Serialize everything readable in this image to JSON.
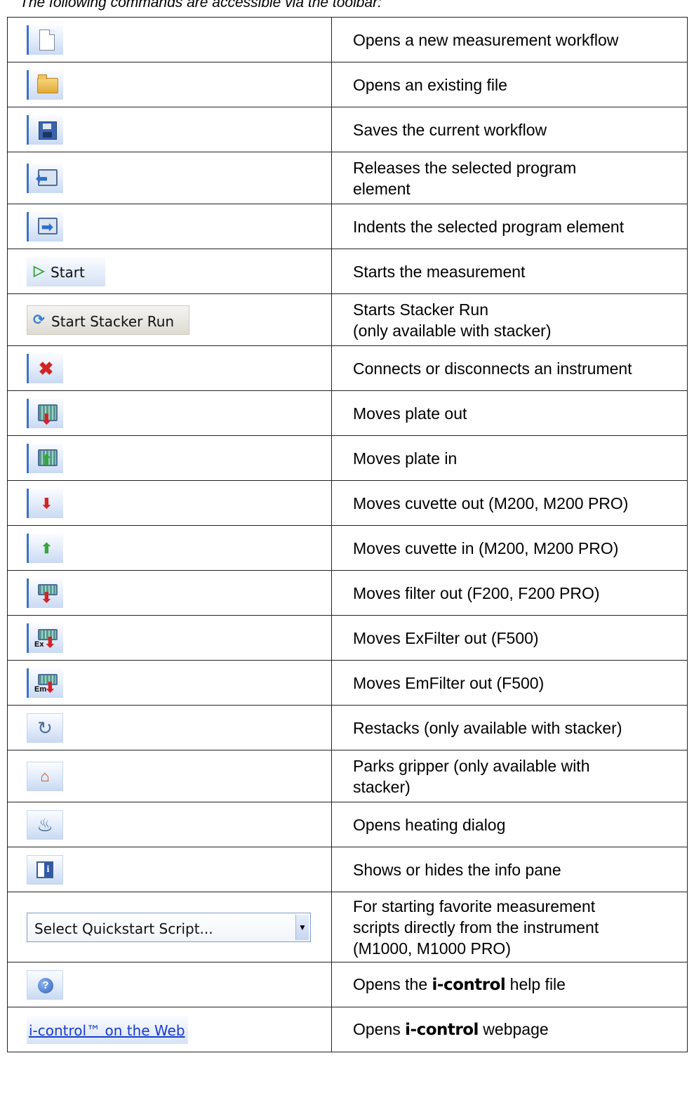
{
  "intro": "The following commands are accessible via the toolbar:",
  "rows": [
    {
      "icon": "new-file-icon",
      "desc": [
        "Opens a new measurement workflow"
      ]
    },
    {
      "icon": "open-folder-icon",
      "desc": [
        "Opens an existing file"
      ]
    },
    {
      "icon": "save-disk-icon",
      "desc": [
        "Saves the current workflow"
      ]
    },
    {
      "icon": "outdent-icon",
      "desc": [
        "Releases the selected program",
        "element"
      ]
    },
    {
      "icon": "indent-icon",
      "desc": [
        "Indents the selected program element"
      ]
    },
    {
      "icon": "start-icon",
      "button_label": "Start",
      "desc": [
        "Starts the measurement"
      ]
    },
    {
      "icon": "stacker-run-icon",
      "button_label": "Start Stacker Run",
      "desc": [
        "Starts Stacker Run",
        "(only available with stacker)"
      ]
    },
    {
      "icon": "connect-icon",
      "desc": [
        "Connects or disconnects an instrument"
      ]
    },
    {
      "icon": "plate-out-icon",
      "desc": [
        "Moves plate out"
      ]
    },
    {
      "icon": "plate-in-icon",
      "desc": [
        "Moves plate in"
      ]
    },
    {
      "icon": "cuvette-out-icon",
      "desc": [
        "Moves cuvette out (M200, M200 PRO)"
      ]
    },
    {
      "icon": "cuvette-in-icon",
      "desc": [
        "Moves cuvette in (M200, M200 PRO)"
      ]
    },
    {
      "icon": "filter-out-icon",
      "desc": [
        "Moves filter out (F200, F200 PRO)"
      ]
    },
    {
      "icon": "exfilter-out-icon",
      "icon_text": "Ex",
      "desc": [
        "Moves ExFilter out (F500)"
      ]
    },
    {
      "icon": "emfilter-out-icon",
      "icon_text": "Em",
      "desc": [
        "Moves EmFilter out (F500)"
      ]
    },
    {
      "icon": "restack-icon",
      "desc": [
        "Restacks (only available with stacker)"
      ]
    },
    {
      "icon": "park-gripper-icon",
      "desc": [
        "Parks gripper (only available with",
        "stacker)"
      ]
    },
    {
      "icon": "heating-icon",
      "desc": [
        "Opens heating dialog"
      ]
    },
    {
      "icon": "info-pane-icon",
      "desc": [
        "Shows or hides the info pane"
      ]
    },
    {
      "icon": "quickstart-dropdown",
      "combo_value": "Select Quickstart Script...",
      "desc": [
        "For starting favorite measurement",
        "scripts directly from the instrument",
        "(M1000, M1000 PRO)"
      ]
    },
    {
      "icon": "help-icon",
      "desc_pre": "Opens the ",
      "brand": "i-control",
      "desc_post": " help file"
    },
    {
      "icon": "web-link",
      "link_label": "i-control™ on the Web",
      "desc_pre": "Opens ",
      "brand": "i-control",
      "desc_post": " webpage"
    }
  ],
  "colors": {
    "accent": "#3b73c8",
    "border": "#222222",
    "link": "#1a3cc8"
  }
}
